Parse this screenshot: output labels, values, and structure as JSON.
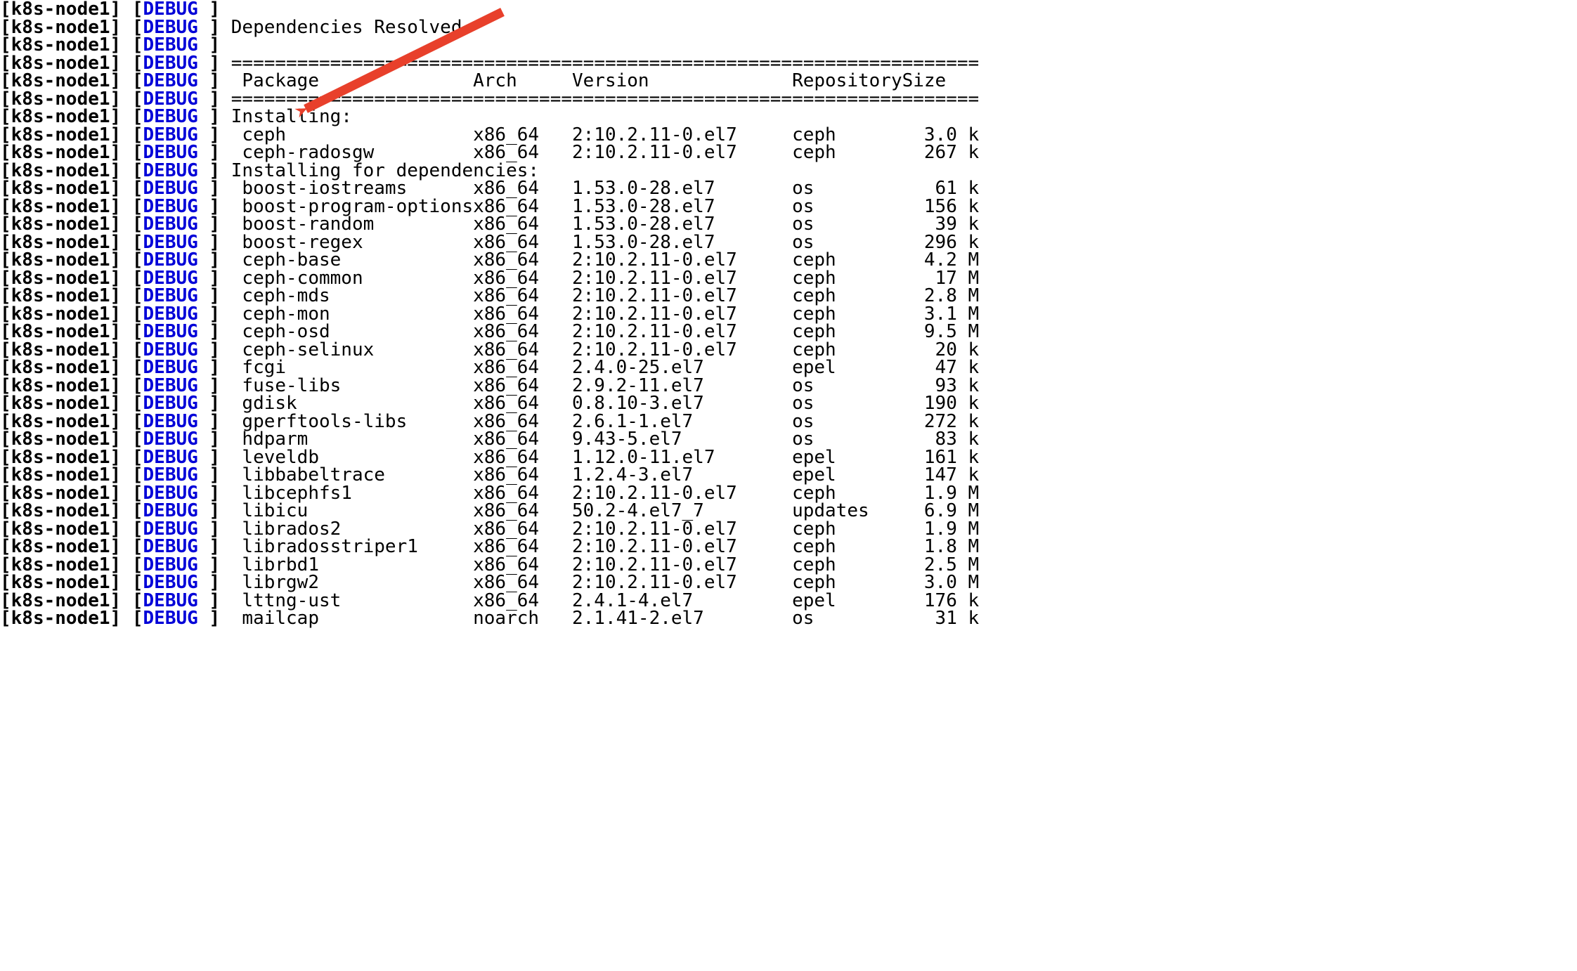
{
  "prefix": {
    "host": "k8s-node1",
    "tag": "DEBUG"
  },
  "messages": {
    "deps_resolved": "Dependencies Resolved",
    "installing": "Installing:",
    "installing_deps": "Installing for dependencies:"
  },
  "separator_top": "================================================================================",
  "separator_bottom": "================================================================================",
  "headers": {
    "package": "Package",
    "arch": "Arch",
    "version": "Version",
    "repository": "Repository",
    "size": "Size"
  },
  "install": [
    {
      "pkg": "ceph",
      "arch": "x86_64",
      "ver": "2:10.2.11-0.el7",
      "repo": "ceph",
      "size": "3.0",
      "unit": "k"
    },
    {
      "pkg": "ceph-radosgw",
      "arch": "x86_64",
      "ver": "2:10.2.11-0.el7",
      "repo": "ceph",
      "size": "267",
      "unit": "k"
    }
  ],
  "deps": [
    {
      "pkg": "boost-iostreams",
      "arch": "x86_64",
      "ver": "1.53.0-28.el7",
      "repo": "os",
      "size": "61",
      "unit": "k"
    },
    {
      "pkg": "boost-program-options",
      "arch": "x86_64",
      "ver": "1.53.0-28.el7",
      "repo": "os",
      "size": "156",
      "unit": "k"
    },
    {
      "pkg": "boost-random",
      "arch": "x86_64",
      "ver": "1.53.0-28.el7",
      "repo": "os",
      "size": "39",
      "unit": "k"
    },
    {
      "pkg": "boost-regex",
      "arch": "x86_64",
      "ver": "1.53.0-28.el7",
      "repo": "os",
      "size": "296",
      "unit": "k"
    },
    {
      "pkg": "ceph-base",
      "arch": "x86_64",
      "ver": "2:10.2.11-0.el7",
      "repo": "ceph",
      "size": "4.2",
      "unit": "M"
    },
    {
      "pkg": "ceph-common",
      "arch": "x86_64",
      "ver": "2:10.2.11-0.el7",
      "repo": "ceph",
      "size": "17",
      "unit": "M"
    },
    {
      "pkg": "ceph-mds",
      "arch": "x86_64",
      "ver": "2:10.2.11-0.el7",
      "repo": "ceph",
      "size": "2.8",
      "unit": "M"
    },
    {
      "pkg": "ceph-mon",
      "arch": "x86_64",
      "ver": "2:10.2.11-0.el7",
      "repo": "ceph",
      "size": "3.1",
      "unit": "M"
    },
    {
      "pkg": "ceph-osd",
      "arch": "x86_64",
      "ver": "2:10.2.11-0.el7",
      "repo": "ceph",
      "size": "9.5",
      "unit": "M"
    },
    {
      "pkg": "ceph-selinux",
      "arch": "x86_64",
      "ver": "2:10.2.11-0.el7",
      "repo": "ceph",
      "size": "20",
      "unit": "k"
    },
    {
      "pkg": "fcgi",
      "arch": "x86_64",
      "ver": "2.4.0-25.el7",
      "repo": "epel",
      "size": "47",
      "unit": "k"
    },
    {
      "pkg": "fuse-libs",
      "arch": "x86_64",
      "ver": "2.9.2-11.el7",
      "repo": "os",
      "size": "93",
      "unit": "k"
    },
    {
      "pkg": "gdisk",
      "arch": "x86_64",
      "ver": "0.8.10-3.el7",
      "repo": "os",
      "size": "190",
      "unit": "k"
    },
    {
      "pkg": "gperftools-libs",
      "arch": "x86_64",
      "ver": "2.6.1-1.el7",
      "repo": "os",
      "size": "272",
      "unit": "k"
    },
    {
      "pkg": "hdparm",
      "arch": "x86_64",
      "ver": "9.43-5.el7",
      "repo": "os",
      "size": "83",
      "unit": "k"
    },
    {
      "pkg": "leveldb",
      "arch": "x86_64",
      "ver": "1.12.0-11.el7",
      "repo": "epel",
      "size": "161",
      "unit": "k"
    },
    {
      "pkg": "libbabeltrace",
      "arch": "x86_64",
      "ver": "1.2.4-3.el7",
      "repo": "epel",
      "size": "147",
      "unit": "k"
    },
    {
      "pkg": "libcephfs1",
      "arch": "x86_64",
      "ver": "2:10.2.11-0.el7",
      "repo": "ceph",
      "size": "1.9",
      "unit": "M"
    },
    {
      "pkg": "libicu",
      "arch": "x86_64",
      "ver": "50.2-4.el7_7",
      "repo": "updates",
      "size": "6.9",
      "unit": "M"
    },
    {
      "pkg": "librados2",
      "arch": "x86_64",
      "ver": "2:10.2.11-0.el7",
      "repo": "ceph",
      "size": "1.9",
      "unit": "M"
    },
    {
      "pkg": "libradosstriper1",
      "arch": "x86_64",
      "ver": "2:10.2.11-0.el7",
      "repo": "ceph",
      "size": "1.8",
      "unit": "M"
    },
    {
      "pkg": "librbd1",
      "arch": "x86_64",
      "ver": "2:10.2.11-0.el7",
      "repo": "ceph",
      "size": "2.5",
      "unit": "M"
    },
    {
      "pkg": "librgw2",
      "arch": "x86_64",
      "ver": "2:10.2.11-0.el7",
      "repo": "ceph",
      "size": "3.0",
      "unit": "M"
    },
    {
      "pkg": "lttng-ust",
      "arch": "x86_64",
      "ver": "2.4.1-4.el7",
      "repo": "epel",
      "size": "176",
      "unit": "k"
    },
    {
      "pkg": "mailcap",
      "arch": "noarch",
      "ver": "2.1.41-2.el7",
      "repo": "os",
      "size": "31",
      "unit": "k"
    }
  ],
  "arrow": {
    "color": "#e8402b"
  },
  "watermark": ""
}
